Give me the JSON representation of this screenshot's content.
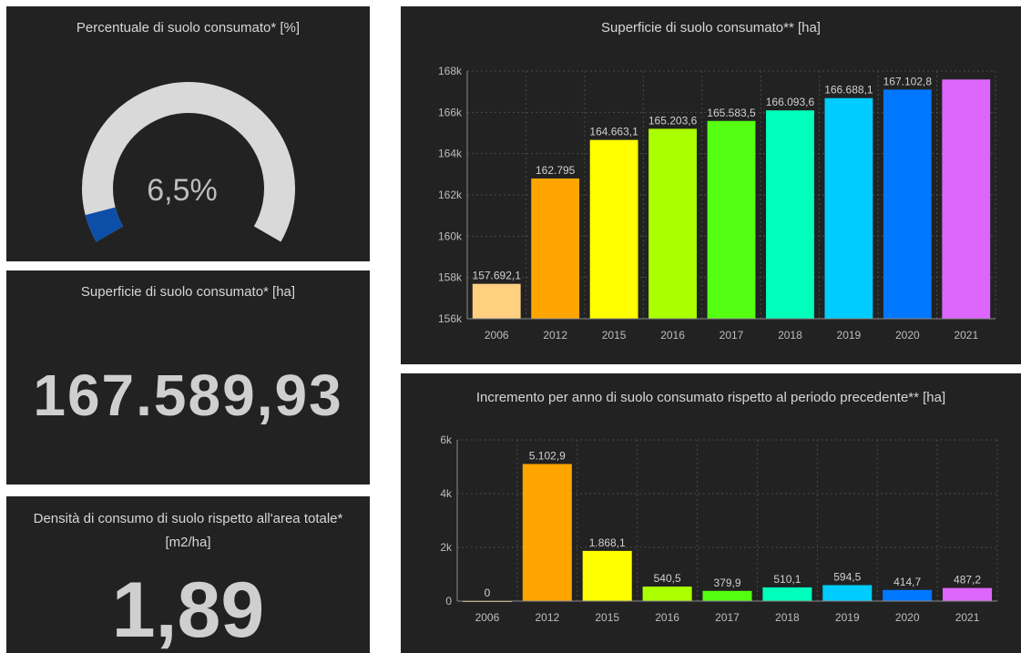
{
  "gauge": {
    "title": "Percentuale di suolo consumato* [%]",
    "value_label": "6,5%",
    "value_percent": 6.5,
    "track_color": "#d9d9d9",
    "fill_color": "#0d4fa8"
  },
  "area_total": {
    "title": "Superficie di suolo consumato* [ha]",
    "value": "167.589,93"
  },
  "density": {
    "title": "Densità di consumo di suolo rispetto all'area totale* [m2/ha]",
    "value": "1,89"
  },
  "chart_data": [
    {
      "type": "bar",
      "title": "Superficie di suolo consumato** [ha]",
      "categories": [
        "2006",
        "2012",
        "2015",
        "2016",
        "2017",
        "2018",
        "2019",
        "2020",
        "2021"
      ],
      "values": [
        157692.1,
        162795,
        164663.1,
        165203.6,
        165583.5,
        166093.6,
        166688.1,
        167102.8,
        167589.93
      ],
      "data_labels": [
        "157.692,1",
        "162.795",
        "164.663,1",
        "165.203,6",
        "165.583,5",
        "166.093,6",
        "166.688,1",
        "167.102,8",
        ""
      ],
      "colors": [
        "#ffd080",
        "#ffa500",
        "#ffff00",
        "#aaff00",
        "#55ff11",
        "#00ffbb",
        "#00ccff",
        "#0077ff",
        "#dd66ff"
      ],
      "ylim": [
        156000,
        168000
      ],
      "yticks": [
        156000,
        158000,
        160000,
        162000,
        164000,
        166000,
        168000
      ],
      "ytick_labels": [
        "156k",
        "158k",
        "160k",
        "162k",
        "164k",
        "166k",
        "168k"
      ],
      "grid": true
    },
    {
      "type": "bar",
      "title": "Incremento per anno di suolo consumato rispetto al periodo precedente** [ha]",
      "categories": [
        "2006",
        "2012",
        "2015",
        "2016",
        "2017",
        "2018",
        "2019",
        "2020",
        "2021"
      ],
      "values": [
        0,
        5102.9,
        1868.1,
        540.5,
        379.9,
        510.1,
        594.5,
        414.7,
        487.2
      ],
      "data_labels": [
        "0",
        "5.102,9",
        "1.868,1",
        "540,5",
        "379,9",
        "510,1",
        "594,5",
        "414,7",
        "487,2"
      ],
      "colors": [
        "#ffd080",
        "#ffa500",
        "#ffff00",
        "#aaff00",
        "#55ff11",
        "#00ffbb",
        "#00ccff",
        "#0077ff",
        "#dd66ff"
      ],
      "ylim": [
        0,
        6000
      ],
      "yticks": [
        0,
        2000,
        4000,
        6000
      ],
      "ytick_labels": [
        "0",
        "2k",
        "4k",
        "6k"
      ],
      "grid": true
    }
  ]
}
